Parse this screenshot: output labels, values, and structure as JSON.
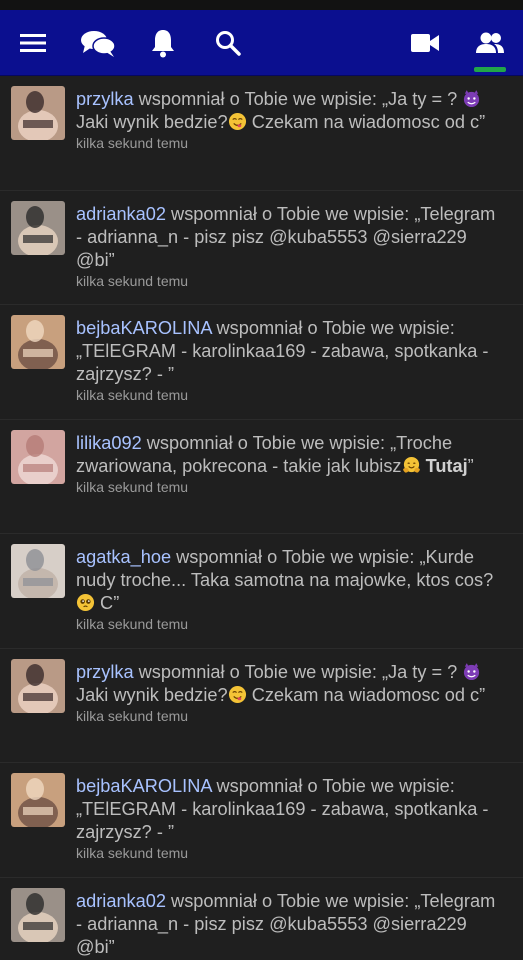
{
  "colors": {
    "navbar": "#0b0f8f",
    "username": "#a8c2ff",
    "text": "#bdbdbd",
    "active_tab": "#21a54a"
  },
  "nav": {
    "icons": [
      "menu-icon",
      "chat-icon",
      "bell-icon",
      "search-icon",
      "video-icon",
      "friends-icon"
    ],
    "active": "friends-icon"
  },
  "feed": [
    {
      "user": "przylka",
      "action": " wspomniał o Tobie we wpisie: ",
      "content_pre": "„Ja ty = ? ",
      "emoji1": "devil",
      "content_mid": " Jaki wynik bedzie?",
      "emoji2": "yum",
      "content_post": " Czekam na wiadomosc od c”",
      "time": "kilka sekund temu"
    },
    {
      "user": "adrianka02",
      "action": " wspomniał o Tobie we wpisie: ",
      "content": "„Telegram - adrianna_n - pisz pisz @kuba5553 @sierra229 @bi”",
      "time": "kilka sekund temu"
    },
    {
      "user": "bejbaKAROLINA",
      "action": " wspomniał o Tobie we wpisie: ",
      "content": "„TElEGRAM - karolinkaa169 - zabawa, spotkanka - zajrzysz? - ”",
      "time": "kilka sekund temu"
    },
    {
      "user": "lilika092",
      "action": " wspomniał o Tobie we wpisie: ",
      "content_pre": "„Troche zwariowana, pokrecona - takie jak lubisz",
      "emoji1": "hug",
      "bold": " Tutaj",
      "content_post": "”",
      "time": "kilka sekund temu"
    },
    {
      "user": "agatka_hoe",
      "action": " wspomniał o Tobie we wpisie: ",
      "content_pre": "„Kurde nudy troche... Taka samotna na majowke, ktos cos? ",
      "emoji1": "pleading",
      "content_post": " C”",
      "time": "kilka sekund temu"
    },
    {
      "user": "przylka",
      "action": " wspomniał o Tobie we wpisie: ",
      "content_pre": "„Ja ty = ? ",
      "emoji1": "devil",
      "content_mid": " Jaki wynik bedzie?",
      "emoji2": "yum",
      "content_post": " Czekam na wiadomosc od c”",
      "time": "kilka sekund temu"
    },
    {
      "user": "bejbaKAROLINA",
      "action": " wspomniał o Tobie we wpisie: ",
      "content": "„TElEGRAM - karolinkaa169 - zabawa, spotkanka - zajrzysz? - ”",
      "time": "kilka sekund temu"
    },
    {
      "user": "adrianka02",
      "action": " wspomniał o Tobie we wpisie: ",
      "content": "„Telegram - adrianna_n - pisz pisz @kuba5553 @sierra229 @bi”",
      "time": "kilka sekund temu"
    }
  ]
}
